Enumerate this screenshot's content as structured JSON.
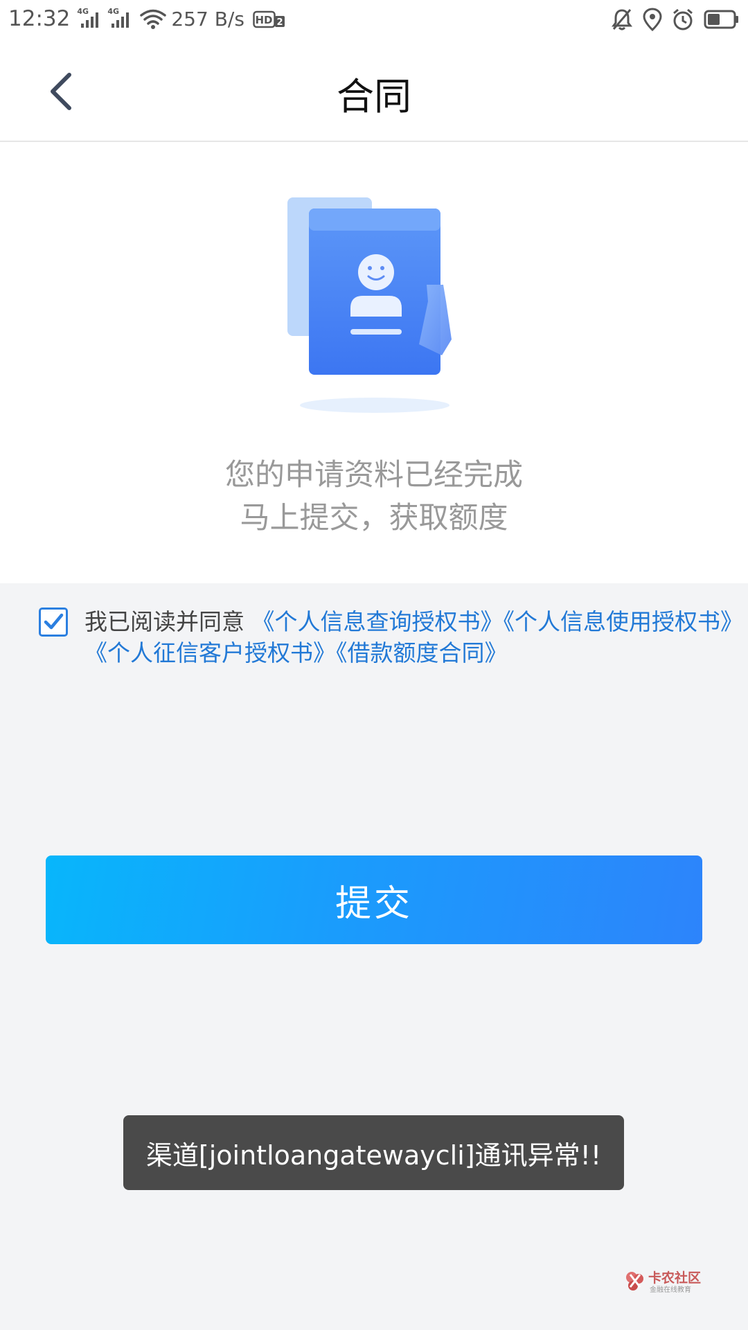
{
  "status_bar": {
    "time": "12:32",
    "network_tag_1": "4G",
    "network_tag_2": "4G",
    "speed": "257 B/s",
    "hd_label": "HD",
    "hd_index": "2",
    "icons": [
      "signal-icon",
      "signal-icon",
      "wifi-icon",
      "hd-icon",
      "bell-muted-icon",
      "location-icon",
      "alarm-icon",
      "battery-icon"
    ]
  },
  "header": {
    "title": "合同",
    "back_icon": "chevron-left-icon"
  },
  "hero": {
    "illustration_icon": "contract-profile-icon",
    "line1": "您的申请资料已经完成",
    "line2": "马上提交，获取额度"
  },
  "agreement": {
    "checked": true,
    "prefix": "我已阅读并同意",
    "links": [
      "《个人信息查询授权书》",
      "《个人信息使用授权书》",
      "《个人征信客户授权书》",
      "《借款额度合同》"
    ]
  },
  "submit": {
    "label": "提交"
  },
  "toast": {
    "message": "渠道[jointloangatewaycli]通讯异常!!"
  },
  "watermark": {
    "title": "卡农社区",
    "subtitle": "金融在线教育"
  },
  "colors": {
    "accent": "#2279d6",
    "button_start": "#08b6fb",
    "button_end": "#2d84fb",
    "toast_bg": "#4a4a4a",
    "page_bg": "#f3f4f6"
  }
}
